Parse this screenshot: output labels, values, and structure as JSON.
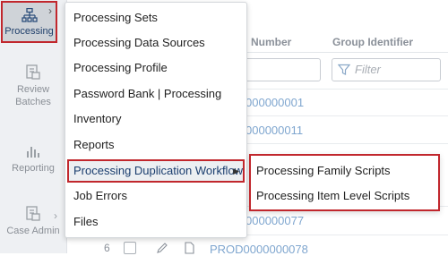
{
  "nav": {
    "items": [
      {
        "label": "Processing",
        "icon": "sitemap-icon",
        "active": true
      },
      {
        "label": "Review Batches",
        "icon": "batches-icon",
        "active": false
      },
      {
        "label": "Reporting",
        "icon": "bar-chart-icon",
        "active": false
      },
      {
        "label": "Case Admin",
        "icon": "case-admin-icon",
        "active": false
      }
    ]
  },
  "grid": {
    "columns": [
      "Number",
      "Group Identifier"
    ],
    "filter_placeholder": "Filter",
    "filter_partial": "er",
    "rows": [
      {
        "control_number": "000000001"
      },
      {
        "control_number": "000000011"
      },
      {
        "control_number": "000000077"
      },
      {
        "row_num": "6",
        "control_number": "PROD0000000078"
      }
    ]
  },
  "menu": {
    "items": [
      {
        "label": "Processing Sets"
      },
      {
        "label": "Processing Data Sources"
      },
      {
        "label": "Processing Profile"
      },
      {
        "label": "Password Bank | Processing"
      },
      {
        "label": "Inventory"
      },
      {
        "label": "Reports"
      },
      {
        "label": "Processing Duplication Workflow",
        "has_submenu": true
      },
      {
        "label": "Job Errors"
      },
      {
        "label": "Files"
      }
    ]
  },
  "submenu": {
    "items": [
      {
        "label": "Processing Family Scripts"
      },
      {
        "label": "Processing Item Level Scripts"
      }
    ]
  },
  "colors": {
    "highlight_border": "#c1272d",
    "link": "#7fa6cf",
    "rail_bg": "#eef0f3"
  }
}
